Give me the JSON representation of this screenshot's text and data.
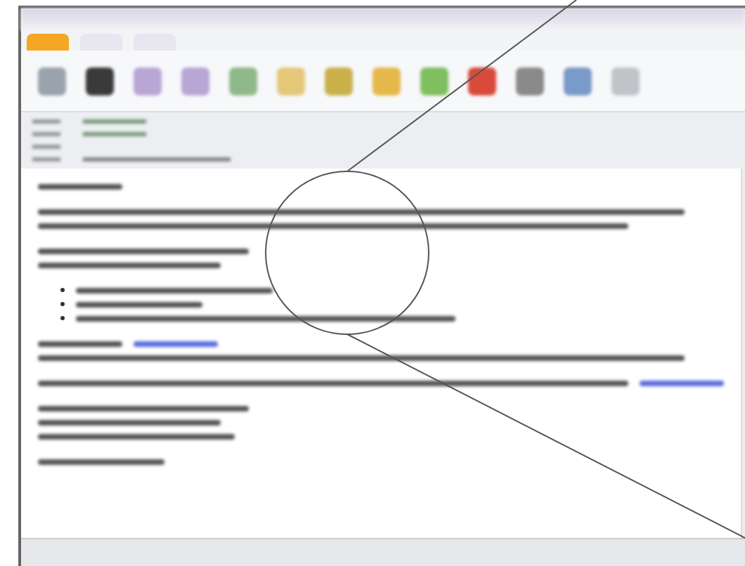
{
  "ribbon": {
    "tabs": [
      {
        "selected": true
      },
      {
        "selected": false
      },
      {
        "selected": false
      }
    ],
    "icons": [
      {
        "color": "#9aa3ad"
      },
      {
        "color": "#3a3a3a"
      },
      {
        "color": "#b9a6d6"
      },
      {
        "color": "#b9a6d6"
      },
      {
        "color": "#8fb98a"
      },
      {
        "color": "#e5c77a"
      },
      {
        "color": "#c9b04a"
      },
      {
        "color": "#e5b84a"
      },
      {
        "color": "#7fbf5f"
      },
      {
        "color": "#d84a3a"
      },
      {
        "color": "#8a8a8a"
      },
      {
        "color": "#7a9ac9"
      },
      {
        "color": "#c0c4c8"
      }
    ]
  },
  "header_rows": [
    {
      "kind": "contact"
    },
    {
      "kind": "contact"
    },
    {
      "kind": "empty"
    },
    {
      "kind": "subject"
    }
  ],
  "body": {
    "paragraphs": [
      {
        "kind": "text",
        "lines": [
          {
            "link": false
          }
        ]
      },
      {
        "kind": "text",
        "lines": [
          {
            "link": false
          },
          {
            "link": false
          }
        ]
      },
      {
        "kind": "text",
        "lines": [
          {
            "link": false
          },
          {
            "link": false
          }
        ]
      },
      {
        "kind": "bullet",
        "lines": [
          {
            "link": false
          },
          {
            "link": false
          },
          {
            "link": false
          }
        ]
      },
      {
        "kind": "text",
        "lines": [
          {
            "link": true
          },
          {
            "link": false
          }
        ]
      },
      {
        "kind": "text",
        "lines": [
          {
            "link": true
          }
        ]
      },
      {
        "kind": "text",
        "lines": [
          {
            "link": false
          },
          {
            "link": false
          },
          {
            "link": false
          }
        ]
      },
      {
        "kind": "text",
        "lines": [
          {
            "link": false
          }
        ]
      }
    ]
  }
}
